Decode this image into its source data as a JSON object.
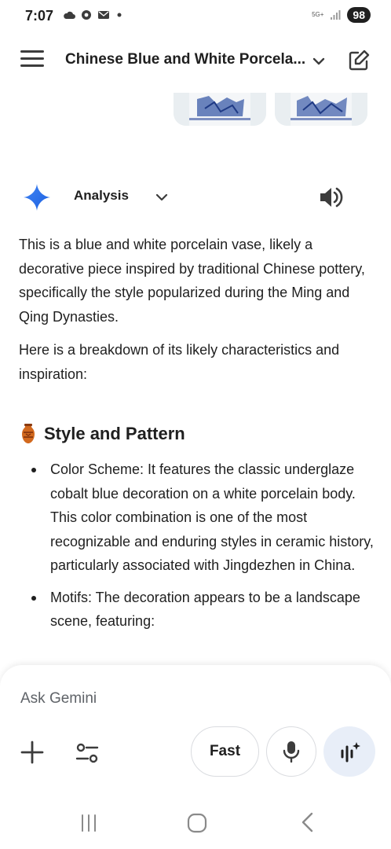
{
  "status_bar": {
    "time": "7:07",
    "network": "5G+",
    "battery": "98"
  },
  "app_bar": {
    "title": "Chinese Blue and White Porcela..."
  },
  "response": {
    "mode_label": "Analysis",
    "paragraphs": [
      "This is a blue and white porcelain vase, likely a decorative piece inspired by traditional Chinese pottery, specifically the style popularized during the Ming and Qing Dynasties.",
      "Here is a breakdown of its likely characteristics and inspiration:"
    ],
    "section_title": "Style and Pattern",
    "bullets": [
      "Color Scheme: It features the classic underglaze cobalt blue decoration on a white porcelain body. This color combination is one of the most recognizable and enduring styles in ceramic history, particularly associated with Jingdezhen in China.",
      "Motifs: The decoration appears to be a landscape scene, featuring:"
    ]
  },
  "input": {
    "placeholder": "Ask Gemini",
    "fast_label": "Fast"
  },
  "colors": {
    "gemini_blue": "#4285f4",
    "live_button_bg": "#e8eef8",
    "text": "#1f1f1f"
  },
  "icons": [
    "menu-icon",
    "chevron-down-icon",
    "edit-icon",
    "gemini-spark-icon",
    "speaker-icon",
    "vase-icon",
    "plus-icon",
    "tools-icon",
    "mic-icon",
    "live-icon",
    "recents-icon",
    "home-icon",
    "back-icon"
  ]
}
